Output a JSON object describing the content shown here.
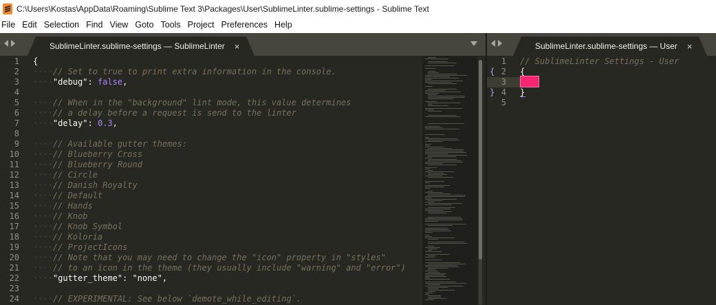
{
  "window": {
    "title": "C:\\Users\\Kostas\\AppData\\Roaming\\Sublime Text 3\\Packages\\User\\SublimeLinter.sublime-settings - Sublime Text"
  },
  "menu": [
    "File",
    "Edit",
    "Selection",
    "Find",
    "View",
    "Goto",
    "Tools",
    "Project",
    "Preferences",
    "Help"
  ],
  "left_tab": {
    "label": "SublimeLinter.sublime-settings — SublimeLinter",
    "close": "×"
  },
  "right_tab": {
    "label": "SublimeLinter.sublime-settings — User",
    "close": "×"
  },
  "left_code": [
    {
      "n": "1",
      "parts": [
        {
          "t": "{",
          "k": "default"
        }
      ]
    },
    {
      "n": "2",
      "parts": [
        {
          "t": "····",
          "k": "guide"
        },
        {
          "t": "// Set to true to print extra information in the console.",
          "k": "comment"
        }
      ]
    },
    {
      "n": "3",
      "parts": [
        {
          "t": "····",
          "k": "guide"
        },
        {
          "t": "\"debug\": ",
          "k": "string"
        },
        {
          "t": "false",
          "k": "const"
        },
        {
          "t": ",",
          "k": "default"
        }
      ]
    },
    {
      "n": "4",
      "parts": []
    },
    {
      "n": "5",
      "parts": [
        {
          "t": "····",
          "k": "guide"
        },
        {
          "t": "// When in the \"background\" lint mode, this value determines",
          "k": "comment"
        }
      ]
    },
    {
      "n": "6",
      "parts": [
        {
          "t": "····",
          "k": "guide"
        },
        {
          "t": "// a delay before a request is send to the linter",
          "k": "comment"
        }
      ]
    },
    {
      "n": "7",
      "parts": [
        {
          "t": "····",
          "k": "guide"
        },
        {
          "t": "\"delay\": ",
          "k": "string"
        },
        {
          "t": "0.3",
          "k": "num"
        },
        {
          "t": ",",
          "k": "default"
        }
      ]
    },
    {
      "n": "8",
      "parts": []
    },
    {
      "n": "9",
      "parts": [
        {
          "t": "····",
          "k": "guide"
        },
        {
          "t": "// Available gutter themes:",
          "k": "comment"
        }
      ]
    },
    {
      "n": "10",
      "parts": [
        {
          "t": "····",
          "k": "guide"
        },
        {
          "t": "// Blueberry Cross",
          "k": "comment"
        }
      ]
    },
    {
      "n": "11",
      "parts": [
        {
          "t": "····",
          "k": "guide"
        },
        {
          "t": "// Blueberry Round",
          "k": "comment"
        }
      ]
    },
    {
      "n": "12",
      "parts": [
        {
          "t": "····",
          "k": "guide"
        },
        {
          "t": "// Circle",
          "k": "comment"
        }
      ]
    },
    {
      "n": "13",
      "parts": [
        {
          "t": "····",
          "k": "guide"
        },
        {
          "t": "// Danish Royalty",
          "k": "comment"
        }
      ]
    },
    {
      "n": "14",
      "parts": [
        {
          "t": "····",
          "k": "guide"
        },
        {
          "t": "// Default",
          "k": "comment"
        }
      ]
    },
    {
      "n": "15",
      "parts": [
        {
          "t": "····",
          "k": "guide"
        },
        {
          "t": "// Hands",
          "k": "comment"
        }
      ]
    },
    {
      "n": "16",
      "parts": [
        {
          "t": "····",
          "k": "guide"
        },
        {
          "t": "// Knob",
          "k": "comment"
        }
      ]
    },
    {
      "n": "17",
      "parts": [
        {
          "t": "····",
          "k": "guide"
        },
        {
          "t": "// Knob Symbol",
          "k": "comment"
        }
      ]
    },
    {
      "n": "18",
      "parts": [
        {
          "t": "····",
          "k": "guide"
        },
        {
          "t": "// Koloria",
          "k": "comment"
        }
      ]
    },
    {
      "n": "19",
      "parts": [
        {
          "t": "····",
          "k": "guide"
        },
        {
          "t": "// ProjectIcons",
          "k": "comment"
        }
      ]
    },
    {
      "n": "20",
      "parts": [
        {
          "t": "····",
          "k": "guide"
        },
        {
          "t": "// Note that you may need to change the \"icon\" property in \"styles\"",
          "k": "comment"
        }
      ]
    },
    {
      "n": "21",
      "parts": [
        {
          "t": "····",
          "k": "guide"
        },
        {
          "t": "// to an icon in the theme (they usually include \"warning\" and \"error\")",
          "k": "comment"
        }
      ]
    },
    {
      "n": "22",
      "parts": [
        {
          "t": "····",
          "k": "guide"
        },
        {
          "t": "\"gutter_theme\": \"none\",",
          "k": "string"
        }
      ]
    },
    {
      "n": "23",
      "parts": []
    },
    {
      "n": "24",
      "parts": [
        {
          "t": "····",
          "k": "guide"
        },
        {
          "t": "// EXPERIMENTAL: See below `demote_while_editing`.",
          "k": "comment"
        }
      ]
    }
  ],
  "right_code": [
    {
      "n": "1",
      "fold": "",
      "parts": [
        {
          "t": "// SublimeLinter Settings - User",
          "k": "comment"
        }
      ]
    },
    {
      "n": "2",
      "fold": "{",
      "parts": [
        {
          "t": "{",
          "k": "default"
        }
      ]
    },
    {
      "n": "3",
      "fold": "",
      "parts": []
    },
    {
      "n": "4",
      "fold": "}",
      "parts": [
        {
          "t": "}",
          "k": "default"
        }
      ]
    },
    {
      "n": "5",
      "fold": "",
      "parts": []
    }
  ],
  "colors": {
    "background": "#272822",
    "comment": "#75715e",
    "constant": "#ae81ff",
    "cursor_highlight": "#f92672"
  }
}
